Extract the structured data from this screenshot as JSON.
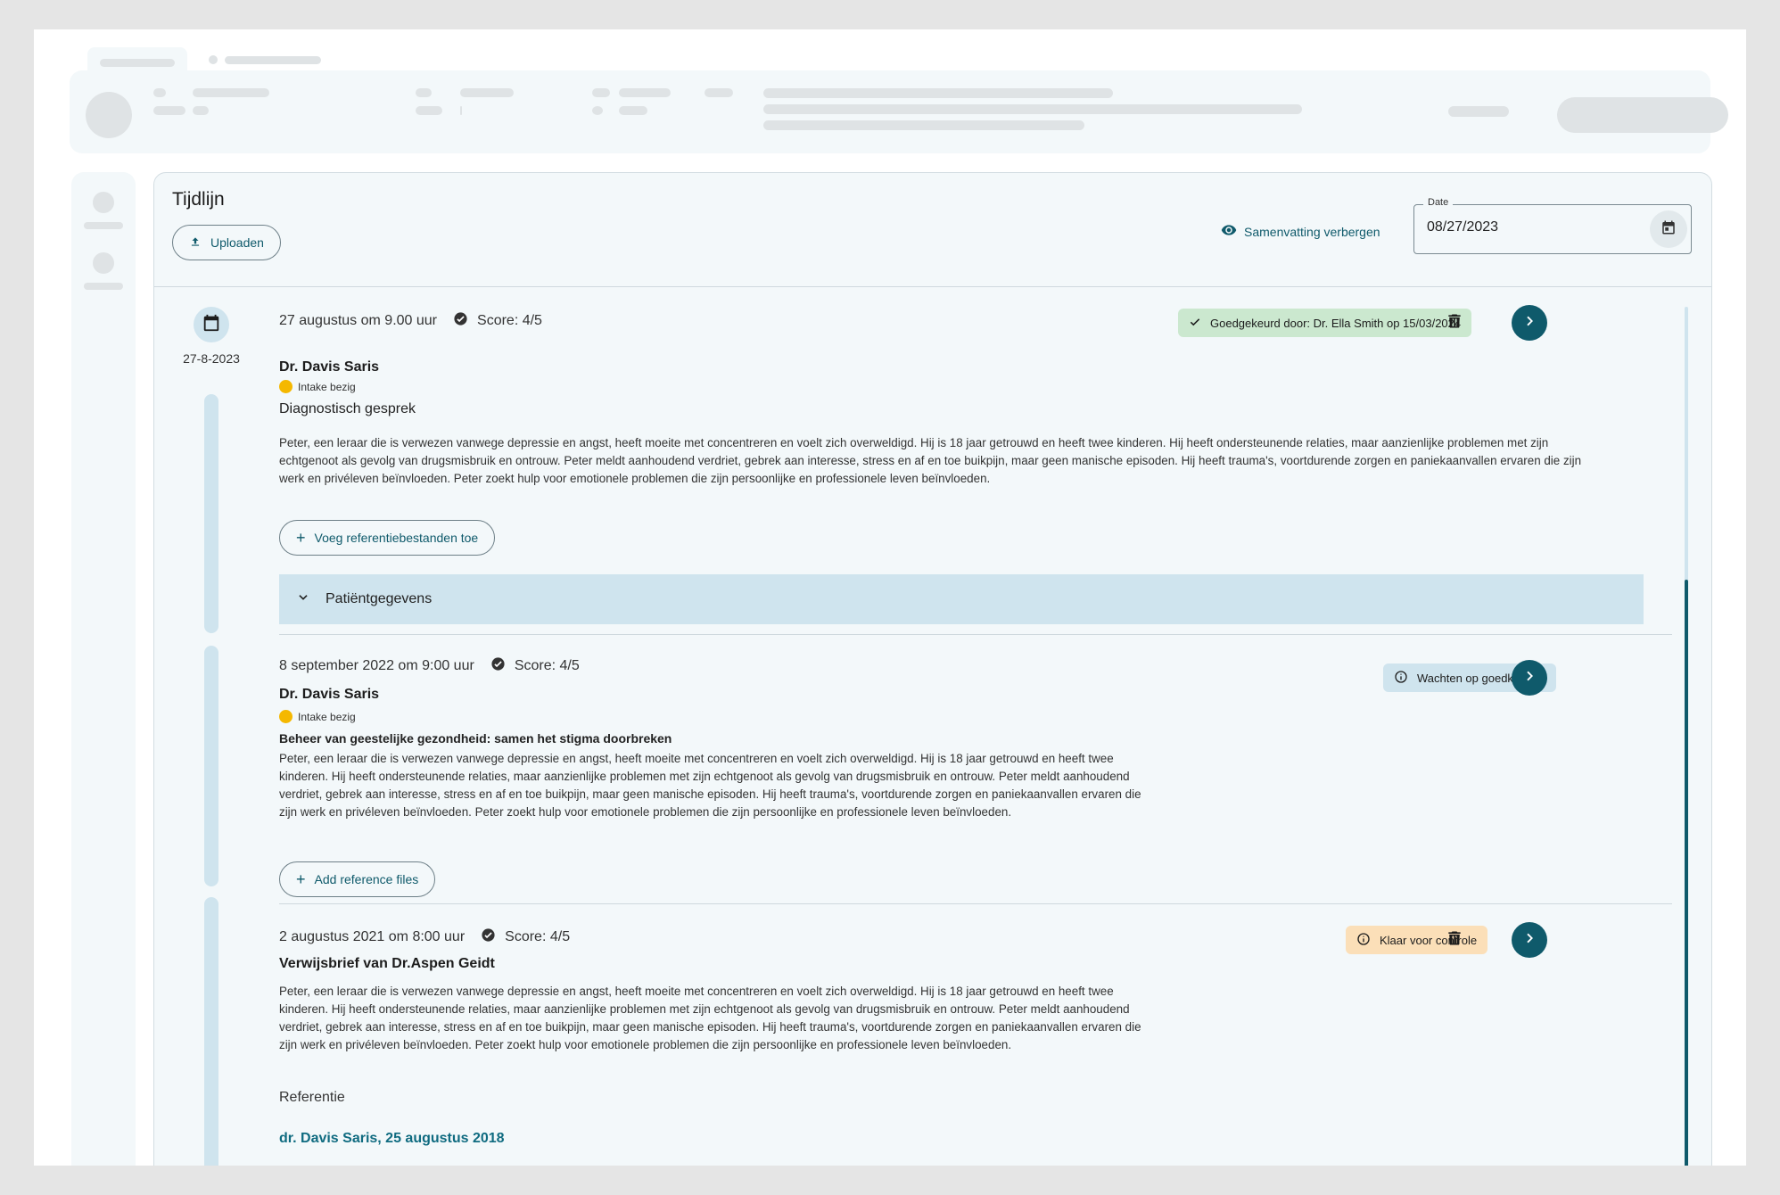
{
  "header": {
    "title": "Tijdlijn",
    "upload_label": "Uploaden",
    "hide_summary_label": "Samenvatting verbergen",
    "date_label": "Date",
    "date_value": "08/27/2023"
  },
  "timeline": {
    "date_marker": "27-8-2023"
  },
  "entries": [
    {
      "datetime": "27 augustus om 9.00 uur",
      "score": "Score: 4/5",
      "badge": "Goedgekeurd door: Dr. Ella Smith op 15/03/2024",
      "doctor": "Dr. Davis Saris",
      "status": "Intake bezig",
      "subtitle": "Diagnostisch gesprek",
      "text": "Peter, een leraar die is verwezen vanwege depressie en angst, heeft moeite met concentreren en voelt zich overweldigd. Hij is 18 jaar getrouwd en heeft twee kinderen. Hij heeft ondersteunende relaties, maar aanzienlijke problemen met zijn echtgenoot als gevolg van drugsmisbruik en ontrouw. Peter meldt aanhoudend verdriet, gebrek aan interesse, stress en af en toe buikpijn, maar geen manische episoden. Hij heeft trauma's, voortdurende zorgen en paniekaanvallen ervaren die zijn werk en privéleven beïnvloeden. Peter zoekt hulp voor emotionele problemen die zijn persoonlijke en professionele leven beïnvloeden.",
      "add_files_label": "Voeg referentiebestanden toe",
      "accordion_label": "Patiëntgegevens"
    },
    {
      "datetime": "8 september 2022 om 9:00 uur",
      "score": "Score: 4/5",
      "badge": "Wachten op goedkeuring",
      "doctor": "Dr. Davis Saris",
      "status": "Intake bezig",
      "subtitle": "Beheer van geestelijke gezondheid: samen het stigma doorbreken",
      "text": "Peter, een leraar die is verwezen vanwege depressie en angst, heeft moeite met concentreren en voelt zich overweldigd. Hij is 18 jaar getrouwd en heeft twee kinderen. Hij heeft ondersteunende relaties, maar aanzienlijke problemen met zijn echtgenoot als gevolg van drugsmisbruik en ontrouw. Peter meldt aanhoudend verdriet, gebrek aan interesse, stress en af en toe buikpijn, maar geen manische episoden. Hij heeft trauma's, voortdurende zorgen en paniekaanvallen ervaren die zijn werk en privéleven beïnvloeden. Peter zoekt hulp voor emotionele problemen die zijn persoonlijke en professionele leven beïnvloeden.",
      "add_files_label": "Add reference files"
    },
    {
      "datetime": "2 augustus 2021 om 8:00 uur",
      "score": "Score: 4/5",
      "badge": "Klaar voor controle",
      "doctor": "Verwijsbrief van Dr.Aspen Geidt",
      "text": "Peter, een leraar die is verwezen vanwege depressie en angst, heeft moeite met concentreren en voelt zich overweldigd. Hij is 18 jaar getrouwd en heeft twee kinderen. Hij heeft ondersteunende relaties, maar aanzienlijke problemen met zijn echtgenoot als gevolg van drugsmisbruik en ontrouw. Peter meldt aanhoudend verdriet, gebrek aan interesse, stress en af en toe buikpijn, maar geen manische episoden. Hij heeft trauma's, voortdurende zorgen en paniekaanvallen ervaren die zijn werk en privéleven beïnvloeden. Peter zoekt hulp voor emotionele problemen die zijn persoonlijke en professionele leven beïnvloeden.",
      "reference_heading": "Referentie",
      "reference_link": "dr. Davis Saris, 25 augustus 2018"
    }
  ],
  "colors": {
    "accent": "#0f5a6b",
    "panel_bg": "#f3f8fa",
    "light_blue": "#cfe4ee",
    "approved": "#cbe8cf",
    "review": "#fbdfb8",
    "status_dot": "#f5b800"
  }
}
